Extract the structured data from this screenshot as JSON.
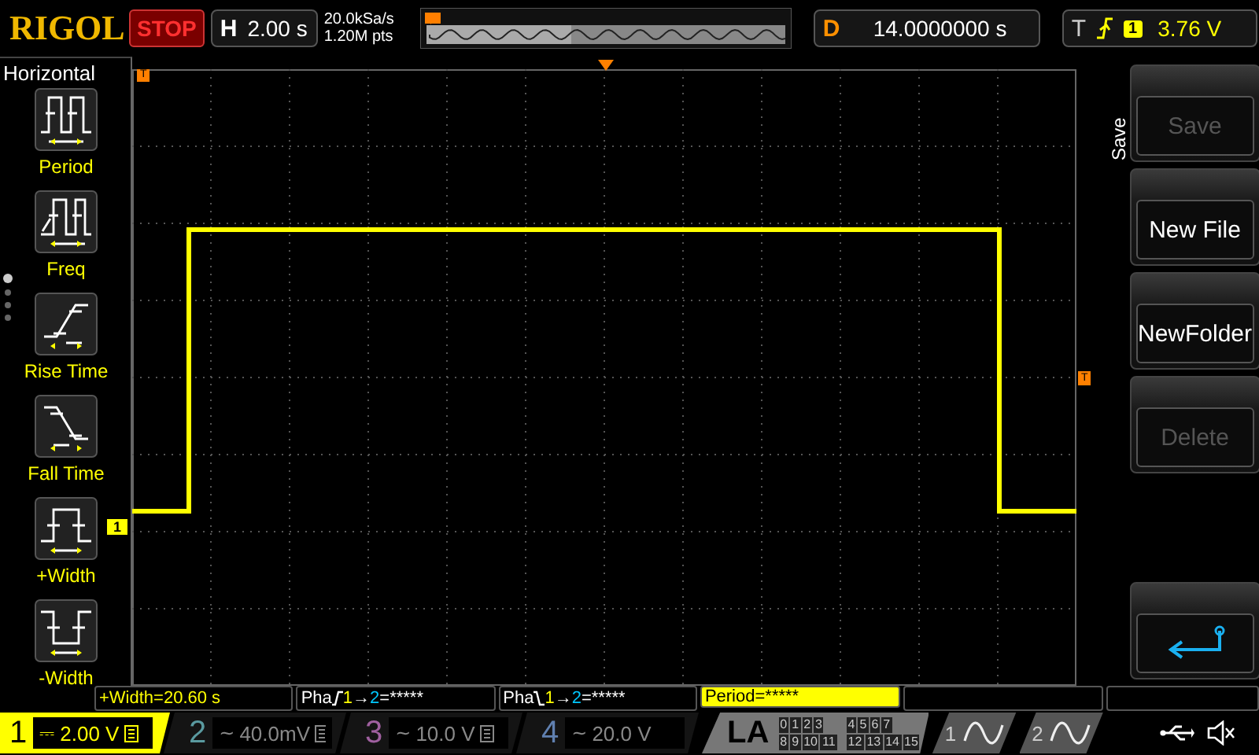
{
  "brand": "RIGOL",
  "run_state": "STOP",
  "horizontal": {
    "label": "H",
    "timebase": "2.00 s",
    "sample_rate": "20.0kSa/s",
    "memory_depth": "1.20M pts"
  },
  "delay": {
    "label": "D",
    "value": "14.0000000 s"
  },
  "trigger": {
    "label": "T",
    "source": "1",
    "level": "3.76 V"
  },
  "left_menu": {
    "title": "Horizontal",
    "items": [
      {
        "label": "Period",
        "kind": "period"
      },
      {
        "label": "Freq",
        "kind": "freq"
      },
      {
        "label": "Rise Time",
        "kind": "rise"
      },
      {
        "label": "Fall Time",
        "kind": "fall"
      },
      {
        "label": "+Width",
        "kind": "pwidth"
      },
      {
        "label": "-Width",
        "kind": "nwidth"
      }
    ],
    "pages": [
      {
        "selected": true
      },
      {
        "selected": false
      },
      {
        "selected": false
      },
      {
        "selected": false
      }
    ]
  },
  "screen": {
    "channel_marker": "1",
    "trigger_marker": "T",
    "level_marker": "T"
  },
  "right_menu": {
    "title": "Save",
    "buttons": [
      {
        "kind": "text",
        "label": "Save",
        "disabled": true
      },
      {
        "kind": "text",
        "label": "New File",
        "disabled": false
      },
      {
        "kind": "text",
        "label": "NewFolder",
        "disabled": false
      },
      {
        "kind": "text",
        "label": "Delete",
        "disabled": true
      },
      {
        "kind": "back",
        "disabled": false
      }
    ]
  },
  "measurements": [
    {
      "kind": "plain",
      "text": "+Width=20.60 s",
      "selected": false
    },
    {
      "kind": "phaserise",
      "label": "Pha",
      "from": "1",
      "arrow": "→",
      "to": "2",
      "value": "=*****",
      "selected": false
    },
    {
      "kind": "phasefall",
      "label": "Pha",
      "from": "1",
      "arrow": "→",
      "to": "2",
      "value": "=*****",
      "selected": false
    },
    {
      "kind": "plain",
      "text": "Period=*****",
      "selected": true
    }
  ],
  "channels": [
    {
      "number": "1",
      "scale": "2.00 V",
      "coupling": "⎓",
      "bw_limit": true,
      "on": true,
      "color": "#ffff00"
    },
    {
      "number": "2",
      "scale": "40.0mV",
      "coupling": "~",
      "bw_limit": true,
      "on": false,
      "color": "#5a9aa0"
    },
    {
      "number": "3",
      "scale": "10.0 V",
      "coupling": "~",
      "bw_limit": true,
      "on": false,
      "color": "#a060a0"
    },
    {
      "number": "4",
      "scale": "20.0 V",
      "coupling": "~",
      "bw_limit": false,
      "on": false,
      "color": "#6080b0"
    }
  ],
  "la": {
    "label": "LA",
    "groups": [
      [
        "0",
        "1",
        "2",
        "3"
      ],
      [
        "4",
        "5",
        "6",
        "7"
      ],
      [
        "8",
        "9",
        "10",
        "11"
      ],
      [
        "12",
        "13",
        "14",
        "15"
      ]
    ]
  },
  "generators": [
    {
      "number": "1"
    },
    {
      "number": "2"
    }
  ]
}
